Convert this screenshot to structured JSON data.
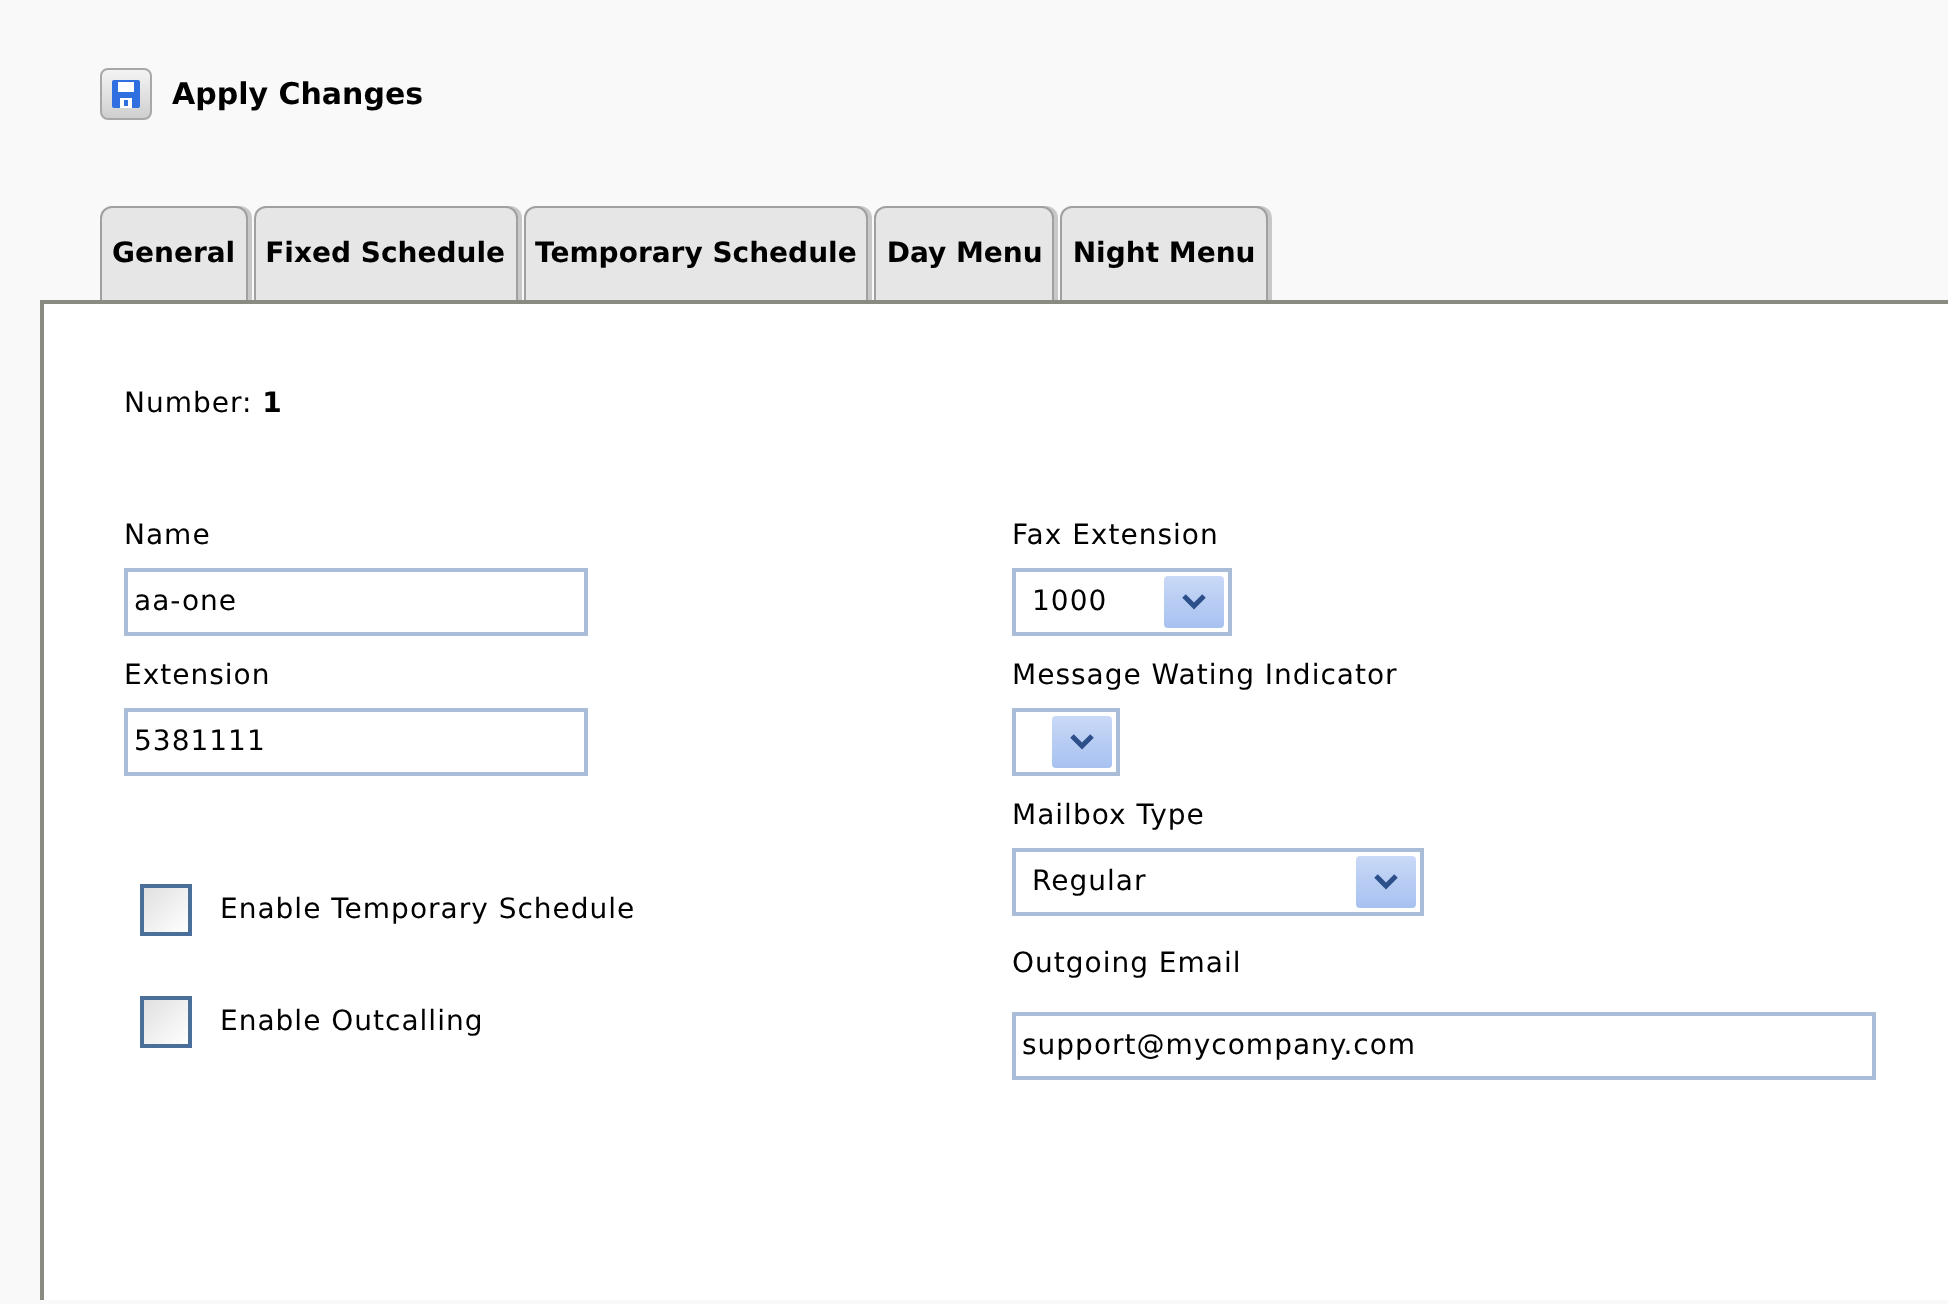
{
  "toolbar": {
    "apply_button": "Apply Changes"
  },
  "tabs": [
    {
      "label": "General",
      "selected": false
    },
    {
      "label": "Fixed Schedule",
      "selected": false
    },
    {
      "label": "Temporary Schedule",
      "selected": false
    },
    {
      "label": "Day Menu",
      "selected": false
    },
    {
      "label": "Night Menu",
      "selected": false
    }
  ],
  "number": {
    "label": "Number:",
    "value": "1"
  },
  "left_fields": [
    {
      "label": "Name",
      "value": "aa-one"
    },
    {
      "label": "Extension",
      "value": "5381111"
    }
  ],
  "checkboxes": [
    {
      "label": "Enable Temporary Schedule",
      "checked": false
    },
    {
      "label": "Enable Outcalling",
      "checked": false
    }
  ],
  "right_fields": [
    {
      "kind": "select",
      "label": "Fax Extension",
      "value": "1000"
    },
    {
      "kind": "select",
      "label": "Message Wating Indicator"
    },
    {
      "kind": "select",
      "label": "Mailbox Type",
      "value": "Regular"
    },
    {
      "kind": "text",
      "label": "Outgoing Email",
      "value": "support@mycompany.com"
    }
  ]
}
